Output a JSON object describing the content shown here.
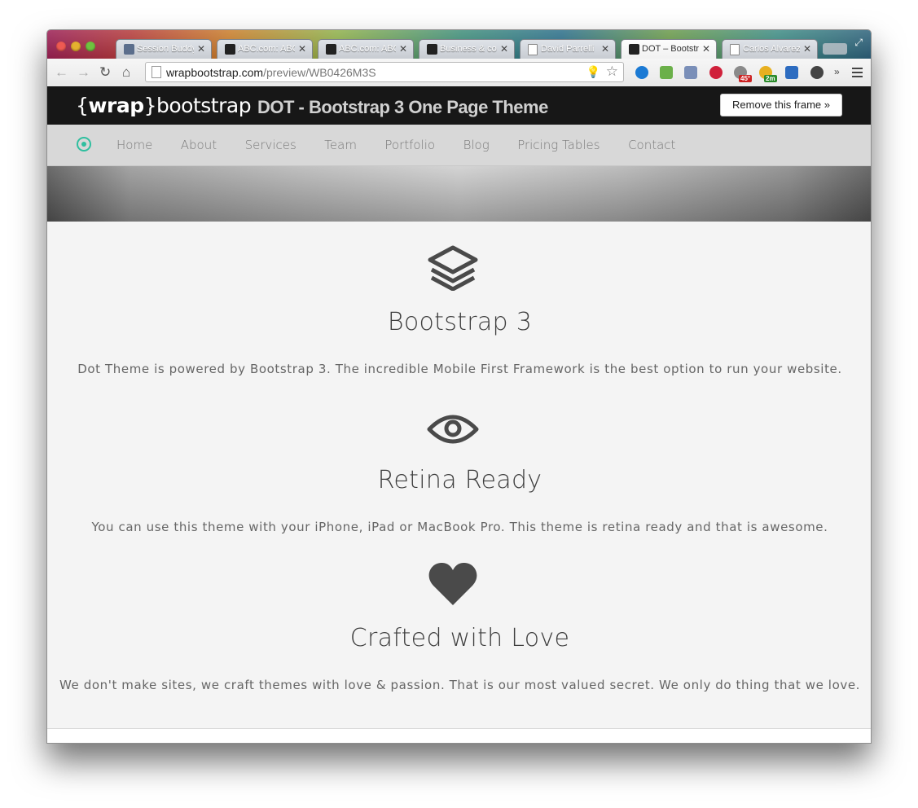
{
  "browser": {
    "tabs": [
      {
        "title": "Session Buddy",
        "favicon": "session-icon",
        "active": false
      },
      {
        "title": "ABC.com: ABC",
        "favicon": "abc-icon",
        "active": false
      },
      {
        "title": "ABC.com: ABC",
        "favicon": "abc-icon",
        "active": false
      },
      {
        "title": "Business & co",
        "favicon": "wrap-icon",
        "active": false
      },
      {
        "title": "David Parrelli",
        "favicon": "doc-icon",
        "active": false
      },
      {
        "title": "DOT – Bootstrap",
        "favicon": "wrap-icon",
        "active": true
      },
      {
        "title": "Carlos Alvarez",
        "favicon": "doc-icon",
        "active": false
      }
    ],
    "url_domain": "wrapbootstrap.com",
    "url_path": "/preview/WB0426M3S",
    "badges": {
      "weather": "45°",
      "timer": "2m"
    }
  },
  "wrapbar": {
    "logo_open": "{",
    "logo_wrap": "wrap",
    "logo_close": "}",
    "logo_rest": "bootstrap",
    "title": "DOT - Bootstrap 3 One Page Theme",
    "remove_label": "Remove this frame »"
  },
  "nav": {
    "items": [
      "Home",
      "About",
      "Services",
      "Team",
      "Portfolio",
      "Blog",
      "Pricing Tables",
      "Contact"
    ]
  },
  "features": [
    {
      "icon": "layers-icon",
      "title": "Bootstrap 3",
      "text": "Dot Theme is powered by Bootstrap 3. The incredible Mobile First Framework is the best option to run your website."
    },
    {
      "icon": "eye-icon",
      "title": "Retina Ready",
      "text": "You can use this theme with your iPhone, iPad or MacBook Pro. This theme is retina ready and that is awesome."
    },
    {
      "icon": "heart-icon",
      "title": "Crafted with Love",
      "text": "We don't make sites, we craft themes with love & passion. That is our most valued secret. We only do thing that we love."
    }
  ],
  "colors": {
    "accent": "#2fbf9f",
    "icon": "#4a4a4a"
  }
}
